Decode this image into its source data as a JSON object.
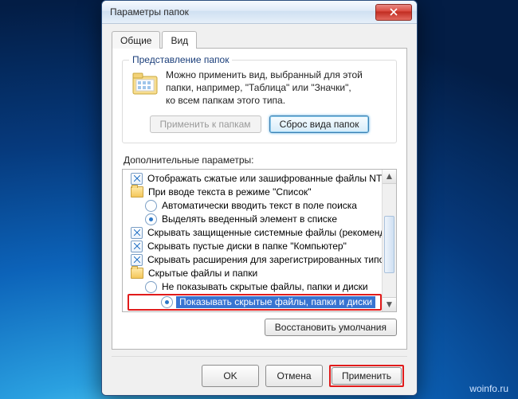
{
  "watermark": "woinfo.ru",
  "window": {
    "title": "Параметры папок"
  },
  "tabs": {
    "general": "Общие",
    "view": "Вид"
  },
  "group": {
    "legend": "Представление папок",
    "desc_line1": "Можно применить вид, выбранный для этой",
    "desc_line2": "папки, например, \"Таблица\" или \"Значки\",",
    "desc_line3": "ко всем папкам этого типа.",
    "apply_btn": "Применить к папкам",
    "reset_btn": "Сброс вида папок"
  },
  "advanced_label": "Дополнительные параметры:",
  "items": {
    "show_encrypted": "Отображать сжатые или зашифрованные файлы NTFS",
    "list_typing": "При вводе текста в режиме \"Список\"",
    "auto_search": "Автоматически вводить текст в поле поиска",
    "highlight": "Выделять введенный элемент в списке",
    "hide_protected": "Скрывать защищенные системные файлы (рекомендуется)",
    "hide_empty": "Скрывать пустые диски в папке \"Компьютер\"",
    "hide_ext": "Скрывать расширения для зарегистрированных типов файлов",
    "hidden_group": "Скрытые файлы и папки",
    "dont_show": "Не показывать скрытые файлы, папки и диски",
    "show_hidden": "Показывать скрытые файлы, папки и диски"
  },
  "restore_btn": "Восстановить умолчания",
  "buttons": {
    "ok": "OK",
    "cancel": "Отмена",
    "apply": "Применить"
  }
}
